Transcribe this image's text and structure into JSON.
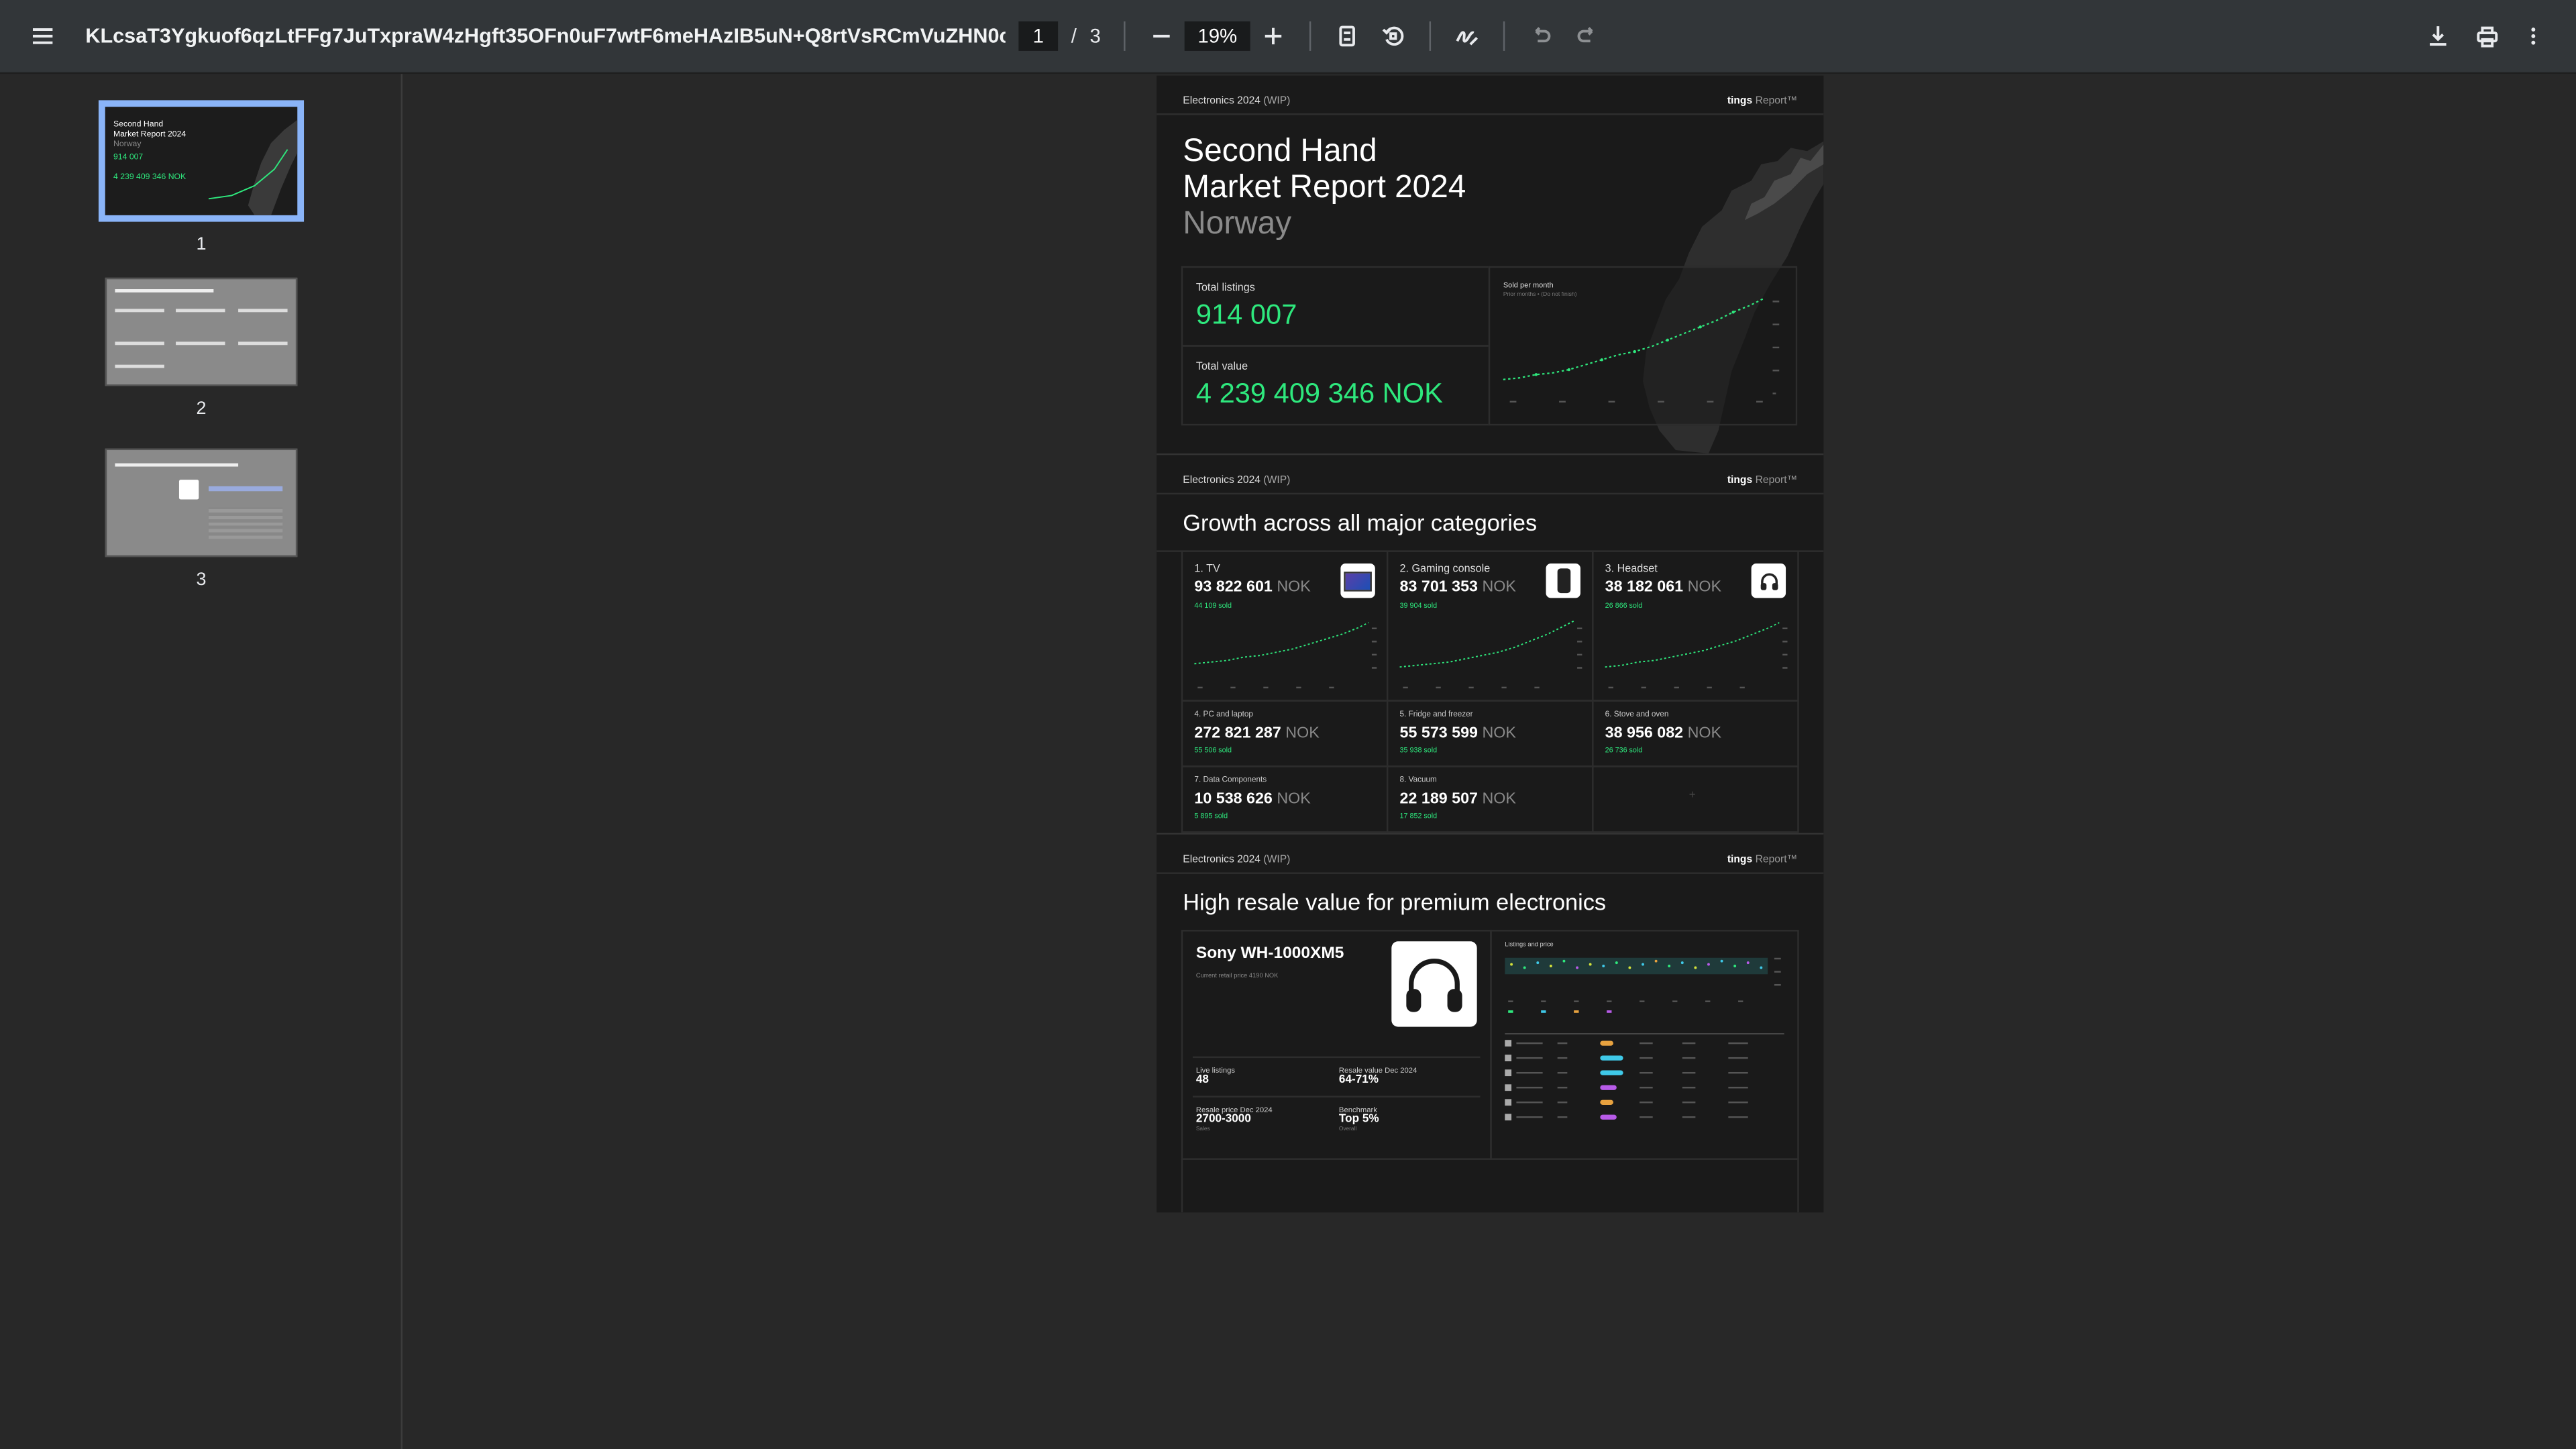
{
  "toolbar": {
    "title": "KLcsaT3Ygkuof6qzLtFFg7JuTxpraW4zHgft35OFn0uF7wtF6meHAzIB5uN+Q8rtVsRCmVuZHN0cmVh...",
    "current_page": "1",
    "page_sep": "/",
    "total_pages": "3",
    "zoom": "19%"
  },
  "thumbnails": [
    {
      "label": "1",
      "lines": [
        "Second Hand",
        "Market Report 2024",
        "Norway",
        "914 007",
        "4 239 409 346 NOK"
      ]
    },
    {
      "label": "2"
    },
    {
      "label": "3"
    }
  ],
  "page": {
    "s1": {
      "tag_prefix": "Electronics 2024",
      "tag_suffix": "(WIP)",
      "brand": "tings",
      "brand_suffix": "Report™",
      "title_line1": "Second Hand",
      "title_line2": "Market Report 2024",
      "country": "Norway",
      "total_listings_label": "Total listings",
      "total_listings": "914 007",
      "total_value_label": "Total value",
      "total_value": "4 239 409 346 NOK",
      "chart_title": "Sold per month",
      "chart_sub": "Prior months • (Do not finish)"
    },
    "s2": {
      "tag_prefix": "Electronics 2024",
      "tag_suffix": "(WIP)",
      "brand": "tings",
      "brand_suffix": "Report™",
      "title": "Growth across all major categories",
      "unit": "NOK",
      "top": [
        {
          "label": "1. TV",
          "value": "93 822 601",
          "sold": "44 109 sold",
          "icon": "tv-icon"
        },
        {
          "label": "2. Gaming console",
          "value": "83 701 353",
          "sold": "39 904 sold",
          "icon": "gaming-console-icon"
        },
        {
          "label": "3. Headset",
          "value": "38 182 061",
          "sold": "26 866 sold",
          "icon": "headset-icon"
        }
      ],
      "mid": [
        {
          "label": "4. PC and laptop",
          "value": "272 821 287",
          "sold": "55 506 sold"
        },
        {
          "label": "5. Fridge and freezer",
          "value": "55 573 599",
          "sold": "35 938 sold"
        },
        {
          "label": "6. Stove and oven",
          "value": "38 956 082",
          "sold": "26 736 sold"
        }
      ],
      "bottom": [
        {
          "label": "7. Data Components",
          "value": "10 538 626",
          "sold": "5 895 sold"
        },
        {
          "label": "8. Vacuum",
          "value": "22 189 507",
          "sold": "17 852 sold"
        }
      ],
      "empty_mark": "+"
    },
    "s3": {
      "tag_prefix": "Electronics 2024",
      "tag_suffix": "(WIP)",
      "brand": "tings",
      "brand_suffix": "Report™",
      "title": "High resale value for premium electronics",
      "product": "Sony WH-1000XM5",
      "product_sub": "Current retail price 4190 NOK",
      "chart_title": "Listings and price",
      "stats": [
        {
          "label": "Live listings",
          "value": "48",
          "sub": ""
        },
        {
          "label": "Resale value Dec 2024",
          "value": "64-71%",
          "sub": ""
        },
        {
          "label": "Resale price Dec 2024",
          "value": "2700-3000",
          "sub": "Sales"
        },
        {
          "label": "Benchmark",
          "value": "Top 5%",
          "sub": "Overall"
        }
      ]
    }
  },
  "colors": {
    "accent_green": "#2ee87d",
    "thumb_selected": "#8ab4f8",
    "toolbar_bg": "#323639"
  }
}
